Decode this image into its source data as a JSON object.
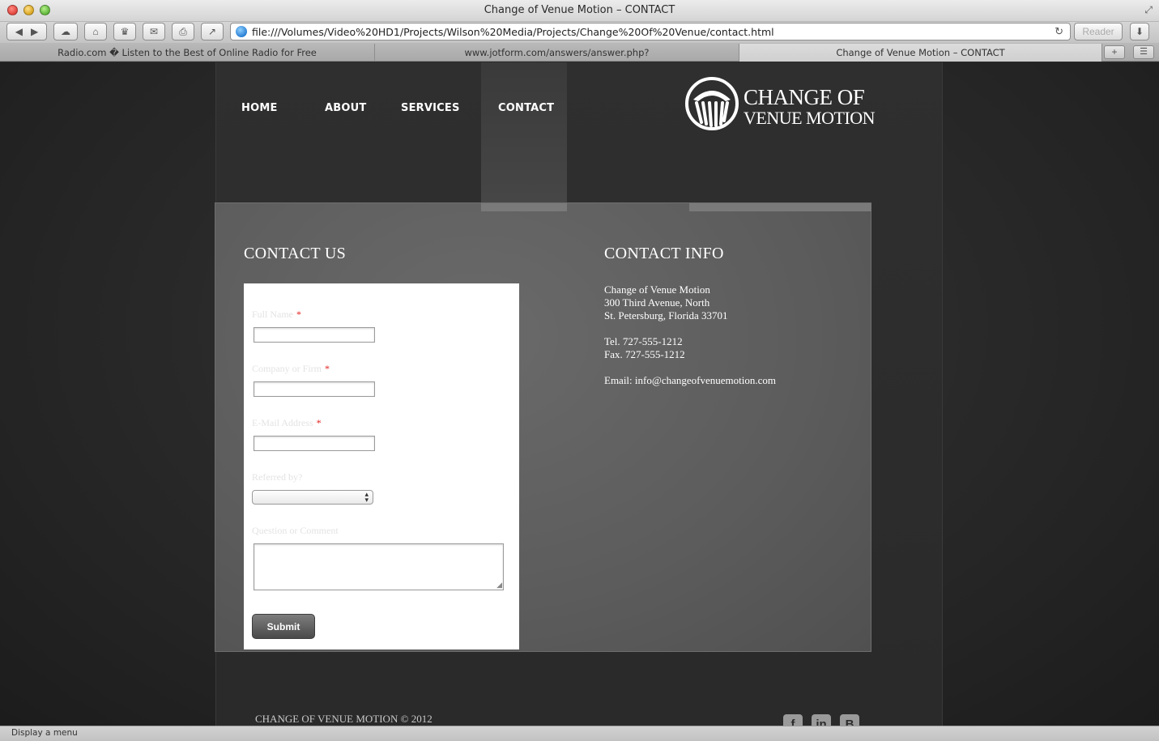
{
  "browser": {
    "window_title": "Change of Venue Motion – CONTACT",
    "url": "file:///Volumes/Video%20HD1/Projects/Wilson%20Media/Projects/Change%20Of%20Venue/contact.html",
    "reader_label": "Reader",
    "status_text": "Display a menu",
    "tabs": [
      {
        "label": "Radio.com � Listen to the Best of Online Radio for Free"
      },
      {
        "label": "www.jotform.com/answers/answer.php?"
      },
      {
        "label": "Change of Venue Motion – CONTACT"
      }
    ],
    "toolbar_icons": [
      "back-icon",
      "forward-icon",
      "icloud-icon",
      "home-icon",
      "top-sites-icon",
      "mail-icon",
      "print-icon",
      "share-icon",
      "reload-icon",
      "download-icon"
    ]
  },
  "site": {
    "nav": [
      {
        "label": "HOME"
      },
      {
        "label": "ABOUT"
      },
      {
        "label": "SERVICES"
      },
      {
        "label": "CONTACT"
      }
    ],
    "active_nav": "CONTACT",
    "logo": {
      "line1": "CHANGE OF",
      "line2": "VENUE MOTION"
    },
    "contact_us_heading": "CONTACT US",
    "contact_info_heading": "CONTACT INFO",
    "form": {
      "full_name_label": "Full Name",
      "company_label": "Company or Firm",
      "email_label": "E-Mail Address",
      "referred_label": "Referred by?",
      "comment_label": "Question or Comment",
      "required_mark": "*",
      "submit_label": "Submit",
      "full_name_value": "",
      "company_value": "",
      "email_value": "",
      "referred_value": "",
      "comment_value": ""
    },
    "contact_info": {
      "company": "Change of Venue Motion",
      "address1": "300 Third Avenue, North",
      "address2": "St. Petersburg, Florida 33701",
      "tel": "Tel. 727-555-1212",
      "fax": "Fax. 727-555-1212",
      "email": "Email: info@changeofvenuemotion.com"
    },
    "footer": {
      "copyright": "CHANGE OF VENUE MOTION © 2012",
      "social": [
        "facebook-icon",
        "linkedin-icon",
        "blogger-icon"
      ]
    }
  },
  "colors": {
    "page_bg": "#2b2b2b",
    "panel_bg": "#5c5c5c",
    "required": "#e21d1d",
    "submit_bg": "#5a5a5a"
  }
}
